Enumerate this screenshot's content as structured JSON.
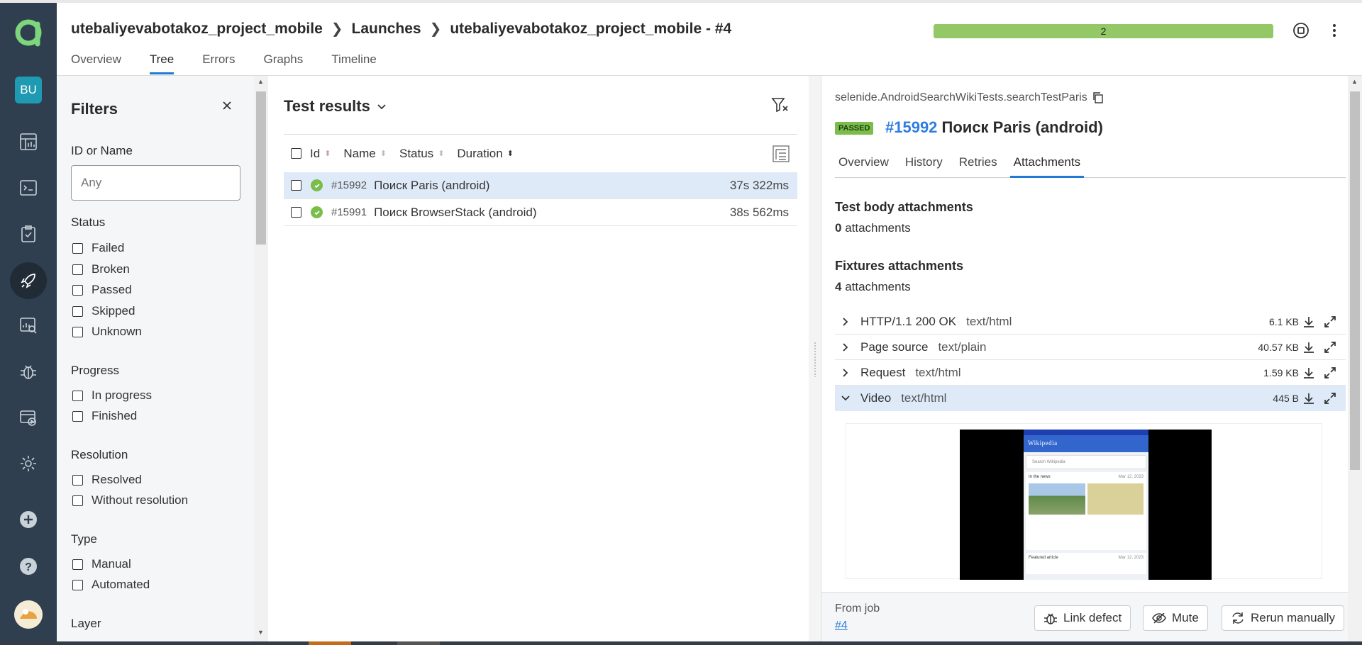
{
  "breadcrumb": {
    "project": "utebaliyevabotakoz_project_mobile",
    "launches": "Launches",
    "launch": "utebaliyevabotakoz_project_mobile - #4"
  },
  "progress": {
    "label": "2",
    "color": "#94c866",
    "fraction": 1.0
  },
  "tabs": [
    "Overview",
    "Tree",
    "Errors",
    "Graphs",
    "Timeline"
  ],
  "active_tab": "Tree",
  "nav": {
    "badge": "BU"
  },
  "filters": {
    "title": "Filters",
    "id_label": "ID or Name",
    "id_placeholder": "Any",
    "status_label": "Status",
    "status": [
      "Failed",
      "Broken",
      "Passed",
      "Skipped",
      "Unknown"
    ],
    "progress_label": "Progress",
    "progress": [
      "In progress",
      "Finished"
    ],
    "resolution_label": "Resolution",
    "resolution": [
      "Resolved",
      "Without resolution"
    ],
    "type_label": "Type",
    "type": [
      "Manual",
      "Automated"
    ],
    "layer_label": "Layer"
  },
  "results": {
    "title": "Test results",
    "columns": {
      "id": "Id",
      "name": "Name",
      "status": "Status",
      "duration": "Duration"
    },
    "rows": [
      {
        "id": "#15992",
        "name": "Поиск Paris (android)",
        "duration": "37s 322ms",
        "selected": true
      },
      {
        "id": "#15991",
        "name": "Поиск BrowserStack (android)",
        "duration": "38s 562ms",
        "selected": false
      }
    ]
  },
  "detail": {
    "fullname": "selenide.AndroidSearchWikiTests.searchTestParis",
    "status": "PASSED",
    "number": "#15992",
    "name": "Поиск Paris (android)",
    "tabs": [
      "Overview",
      "History",
      "Retries",
      "Attachments"
    ],
    "active_tab": "Attachments",
    "body_title": "Test body attachments",
    "body_count": "0",
    "body_suffix": "attachments",
    "fixtures_title": "Fixtures attachments",
    "fixtures_count": "4",
    "fixtures_suffix": "attachments",
    "attachments": [
      {
        "name": "HTTP/1.1 200 OK",
        "type": "text/html",
        "size": "6.1 KB",
        "open": false
      },
      {
        "name": "Page source",
        "type": "text/plain",
        "size": "40.57 KB",
        "open": false
      },
      {
        "name": "Request",
        "type": "text/html",
        "size": "1.59 KB",
        "open": false
      },
      {
        "name": "Video",
        "type": "text/html",
        "size": "445 B",
        "open": true
      }
    ],
    "video": {
      "app_title": "Wikipedia",
      "search_placeholder": "Search Wikipedia",
      "card_title": "In the news",
      "card_date": "Mar 12, 2023",
      "card2_title": "Featured article",
      "card2_date": "Mar 12, 2023"
    }
  },
  "footer": {
    "from_job": "From job",
    "job_link": "#4",
    "link_defect": "Link defect",
    "mute": "Mute",
    "rerun": "Rerun manually"
  }
}
